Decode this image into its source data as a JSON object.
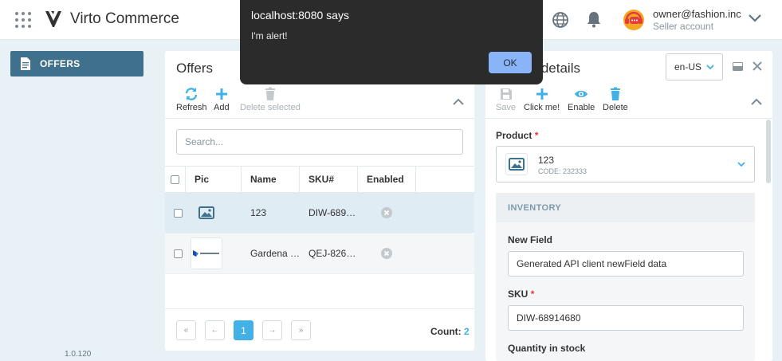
{
  "header": {
    "app_name": "Virto Commerce",
    "user_email": "owner@fashion.inc",
    "user_role": "Seller account"
  },
  "nav": {
    "offers_label": "OFFERS",
    "version": "1.0.120"
  },
  "offers": {
    "title": "Offers",
    "toolbar": {
      "refresh": "Refresh",
      "add": "Add",
      "delete_selected": "Delete selected"
    },
    "search_placeholder": "Search...",
    "columns": [
      "Pic",
      "Name",
      "SKU#",
      "Enabled"
    ],
    "rows": [
      {
        "name": "123",
        "sku": "DIW-689…",
        "enabled": false,
        "pic": "image-placeholder"
      },
      {
        "name": "Gardena …",
        "sku": "QEJ-826…",
        "enabled": false,
        "pic": "dynamics-365-logo"
      }
    ],
    "pager": {
      "first": "«",
      "prev": "←",
      "current": "1",
      "next": "→",
      "last": "»"
    },
    "count_label": "Count:",
    "count_value": "2"
  },
  "details": {
    "title": "er details",
    "language": "en-US",
    "toolbar": {
      "save": "Save",
      "click_me": "Click me!",
      "enable": "Enable",
      "delete": "Delete"
    },
    "product_label": "Product",
    "product_name": "123",
    "product_code": "CODE: 232333",
    "inventory_header": "INVENTORY",
    "new_field_label": "New Field",
    "new_field_value": "Generated API client newField data",
    "sku_label": "SKU",
    "sku_value": "DIW-68914680",
    "quantity_label": "Quantity in stock",
    "required_mark": "*"
  },
  "alert": {
    "title": "localhost:8080 says",
    "message": "I'm alert!",
    "ok_label": "OK"
  },
  "colors": {
    "accent": "#43b0e6",
    "nav_active": "#3f718c",
    "alert_bg": "#2b2b2b",
    "alert_button": "#8ab4f8"
  }
}
